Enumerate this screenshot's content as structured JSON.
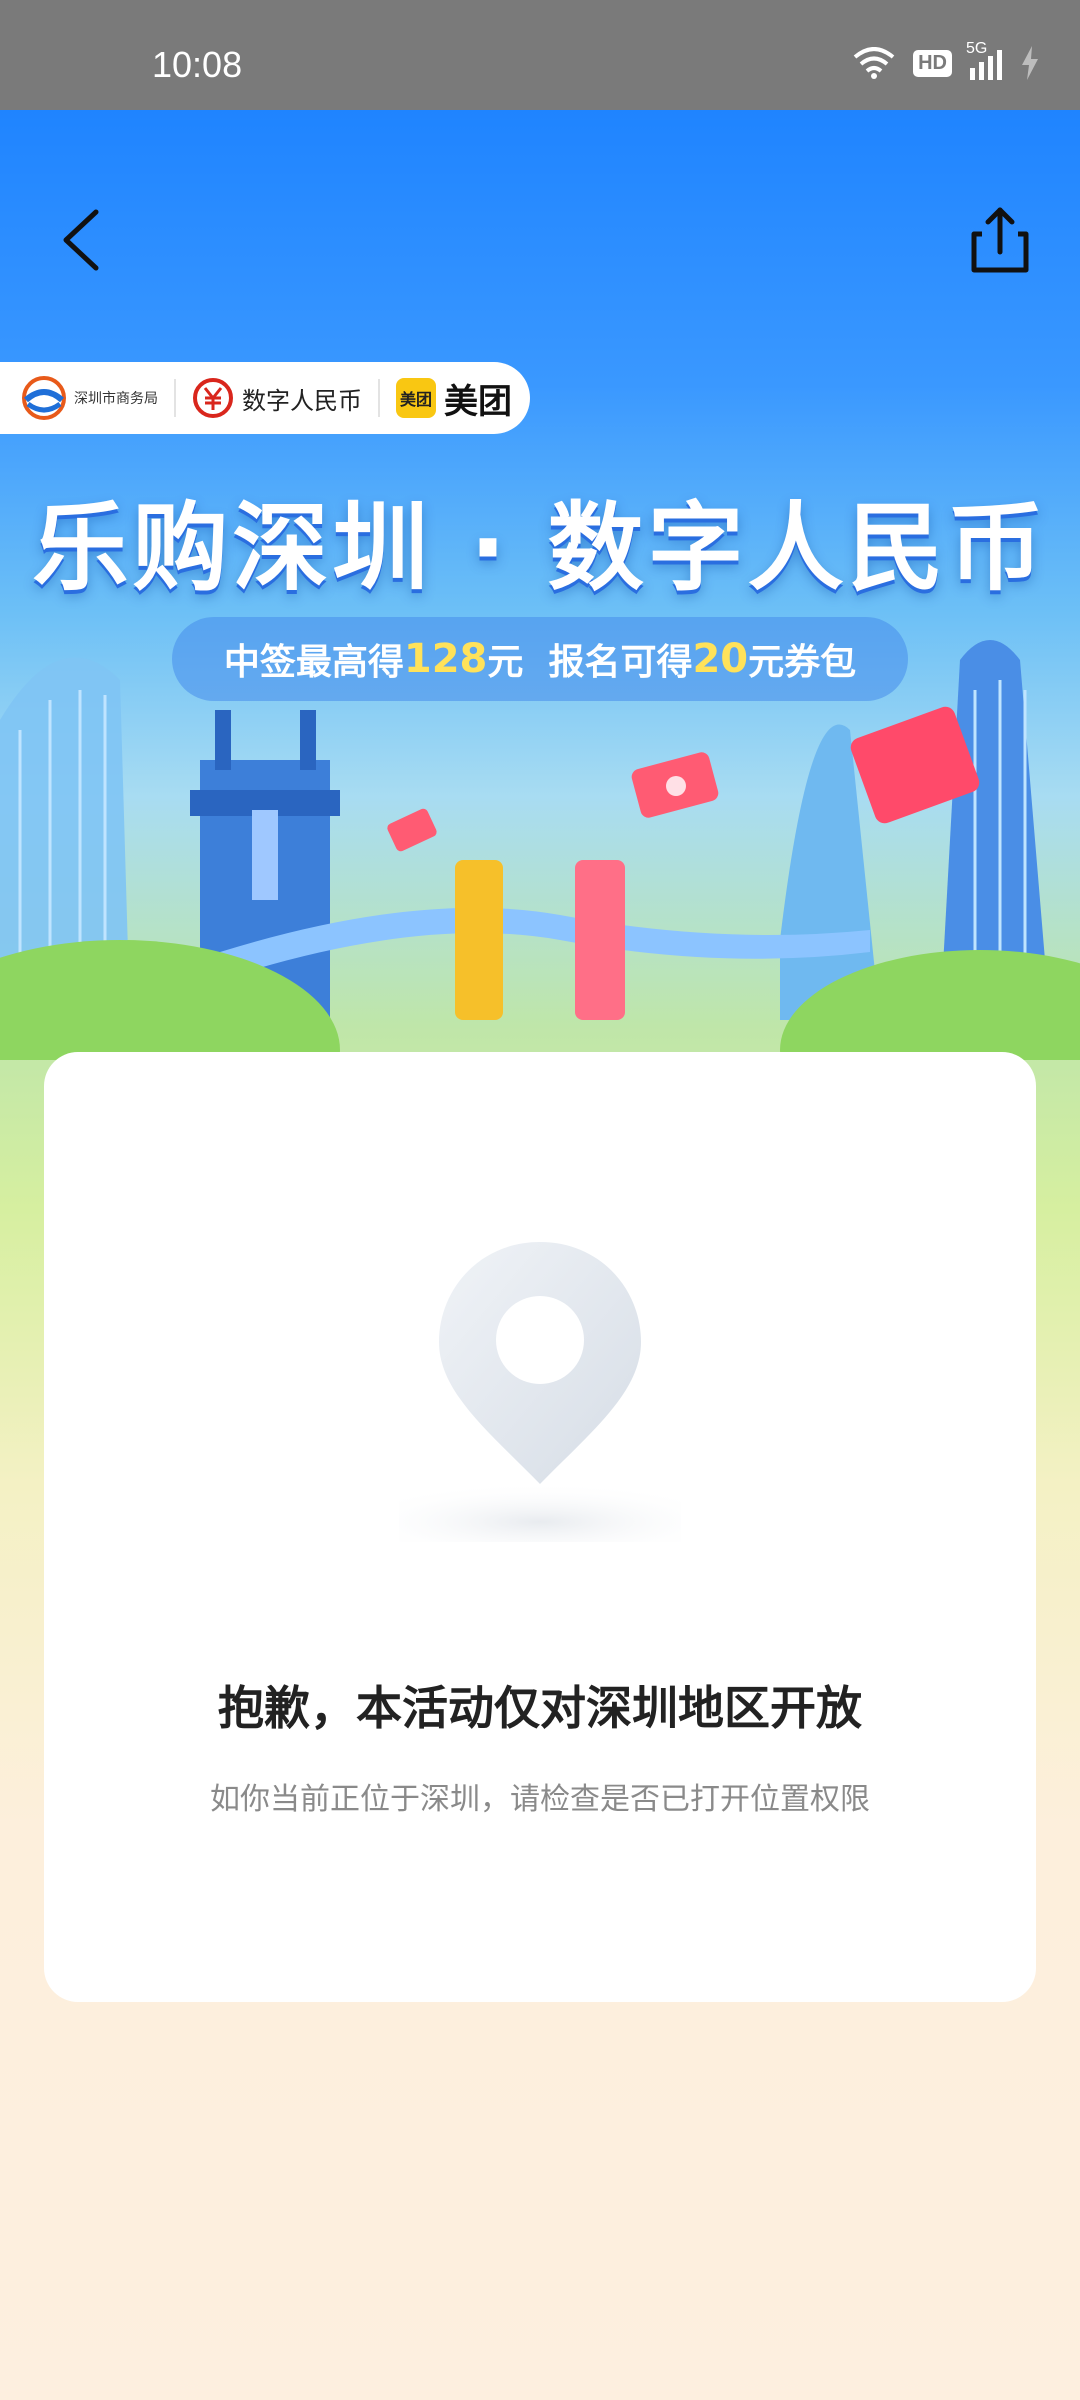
{
  "status": {
    "time": "10:08",
    "hd": "HD",
    "network": "5G"
  },
  "nav": {
    "back_icon": "chevron-left-icon",
    "share_icon": "share-icon"
  },
  "partners": {
    "org": "深圳市商务局",
    "ecny": "数字人民币",
    "meituan_badge": "美团",
    "meituan": "美团"
  },
  "banner": {
    "headline": "乐购深圳 · 数字人民币",
    "sub_prefix": "中签最高得",
    "sub_amount1": "128",
    "sub_mid": "元  报名可得",
    "sub_amount2": "20",
    "sub_suffix": "元券包"
  },
  "card": {
    "icon": "location-pin-icon",
    "title": "抱歉，本活动仅对深圳地区开放",
    "subtitle": "如你当前正位于深圳，请检查是否已打开位置权限"
  },
  "colors": {
    "accent_blue": "#1f84ff",
    "highlight_yellow": "#ffe25a",
    "meituan_yellow": "#f9c712"
  }
}
